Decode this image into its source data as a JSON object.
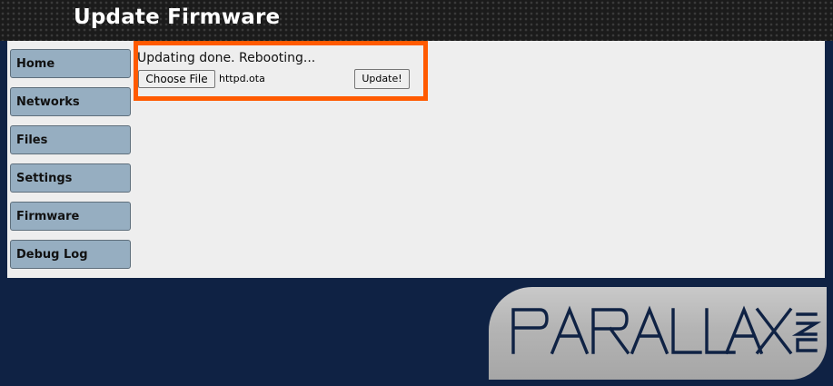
{
  "header": {
    "title": "Update Firmware"
  },
  "nav": {
    "items": [
      {
        "label": "Home"
      },
      {
        "label": "Networks"
      },
      {
        "label": "Files"
      },
      {
        "label": "Settings"
      },
      {
        "label": "Firmware"
      },
      {
        "label": "Debug Log"
      }
    ]
  },
  "firmware": {
    "status": "Updating done. Rebooting...",
    "choose_file_label": "Choose File",
    "file_name": "httpd.ota",
    "update_label": "Update!"
  },
  "logo": {
    "text": "PARALLAX INC",
    "icon": "parallax-logo-icon"
  },
  "colors": {
    "page_background": "#0f2244",
    "nav_button": "#96aec1",
    "highlight": "#ff5a00",
    "content_background": "#eeeeee"
  }
}
